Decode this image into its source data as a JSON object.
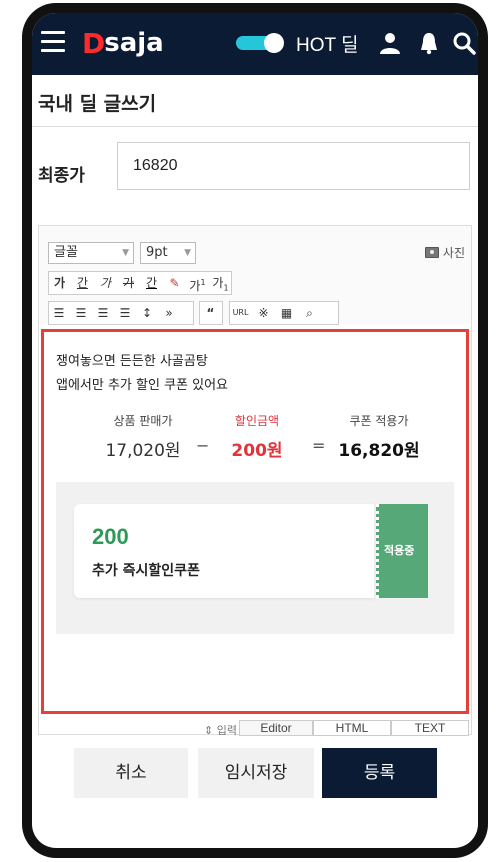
{
  "topbar": {
    "logo_d": "D",
    "logo_rest": "saja",
    "hot_label": "HOT 딜",
    "icons": [
      "menu-icon",
      "user-icon",
      "bell-icon",
      "search-icon"
    ]
  },
  "page": {
    "title": "국내 딜 글쓰기"
  },
  "price": {
    "label": "최종가",
    "value": "16820"
  },
  "editor": {
    "font_select": "글꼴",
    "size_select": "9pt",
    "photo_label": "사진",
    "row1": [
      "가",
      "간",
      "가",
      "가",
      "간",
      "가",
      "가",
      "가"
    ],
    "url_label": "URL",
    "content": {
      "line1": "쟁여놓으면 든든한 사골곰탕",
      "line2": "앱에서만 추가 할인 쿠폰 있어요",
      "col1_label": "상품 판매가",
      "col1_value": "17,020원",
      "op1": "−",
      "col2_label": "할인금액",
      "col2_value": "200원",
      "op2": "=",
      "col3_label": "쿠폰 적용가",
      "col3_value": "16,820원",
      "coupon_amount": "200",
      "coupon_name": "추가 즉시할인쿠폰",
      "coupon_tag": "적용중"
    },
    "tab_hint": "⇕ 입력",
    "tabs": [
      "Editor",
      "HTML",
      "TEXT"
    ]
  },
  "buttons": {
    "cancel": "취소",
    "draft": "임시저장",
    "submit": "등록"
  },
  "colors": {
    "nav": "#0c1b34",
    "accent_red": "#e0333a",
    "coupon_green": "#56a878",
    "toggle": "#26c6da"
  }
}
